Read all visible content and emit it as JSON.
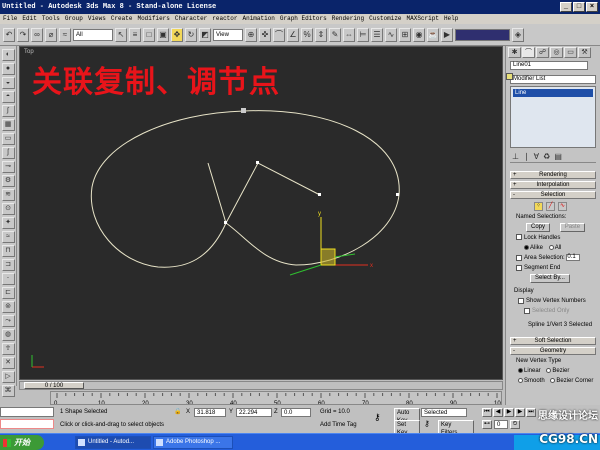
{
  "window": {
    "title": "Untitled - Autodesk 3ds Max 8 - Stand-alone License",
    "controls": [
      "_",
      "□",
      "×"
    ]
  },
  "menu": {
    "items": [
      "File",
      "Edit",
      "Tools",
      "Group",
      "Views",
      "Create",
      "Modifiers",
      "Character",
      "reactor",
      "Animation",
      "Graph Editors",
      "Rendering",
      "Customize",
      "MAXScript",
      "Help"
    ]
  },
  "toolbar": {
    "selection_filter": "All",
    "reference_coord": "View"
  },
  "viewport": {
    "label": "Top",
    "overlay_title": "关联复制、调节点",
    "gizmo_axes": {
      "x": "x",
      "y": "y"
    }
  },
  "command_panel": {
    "object_name": "Line01",
    "modifier_list": "Modifier List",
    "stack_item": "Line",
    "rollouts": {
      "rendering": "Rendering",
      "interpolation": "Interpolation",
      "selection": "Selection",
      "soft_selection": "Soft Selection",
      "geometry": "Geometry"
    },
    "named_selections_label": "Named Selections:",
    "copy_button": "Copy",
    "paste_button": "Paste",
    "lock_handles": "Lock Handles",
    "alike": "Alike",
    "all": "All",
    "area_selection": "Area Selection:",
    "area_value": "0.1",
    "segment_end": "Segment End",
    "select_by": "Select By...",
    "display_label": "Display",
    "show_vertex_numbers": "Show Vertex Numbers",
    "selected_only": "Selected Only",
    "selection_status": "Spline 1/Vert 3 Selected",
    "new_vertex_type": "New Vertex Type",
    "linear": "Linear",
    "bezier": "Bezier",
    "smooth": "Smooth",
    "bezier_corner": "Bezier Corner"
  },
  "timeline": {
    "frame_display": "0 / 100",
    "ticks": [
      "0",
      "10",
      "20",
      "30",
      "40",
      "50",
      "60",
      "70",
      "80",
      "90",
      "100"
    ]
  },
  "status": {
    "selection_info": "1 Shape Selected",
    "prompt": "Click or click-and-drag to select objects",
    "x_label": "X",
    "x_value": "31.818",
    "y_label": "Y",
    "y_value": "22.294",
    "z_label": "Z",
    "z_value": "0.0",
    "grid": "Grid = 10.0",
    "add_time_tag": "Add Time Tag",
    "auto_key": "Auto Key",
    "selected_dropdown": "Selected",
    "set_key": "Set Key",
    "key_filters": "Key Filters..."
  },
  "taskbar": {
    "start": "开始",
    "items": [
      "Untitled - Autod...",
      "Adobe Photoshop ..."
    ]
  },
  "watermark": {
    "line1": "思缘设计论坛",
    "line2": "CG98.CN"
  },
  "colors": {
    "title_bar": "#0a246a",
    "viewport_bg": "#2a2a2a",
    "spline": "#e8e4c8",
    "overlay_text": "#e8141a",
    "axis_x": "#e03020",
    "axis_y": "#f0e020",
    "taskbar": "#245edb"
  }
}
